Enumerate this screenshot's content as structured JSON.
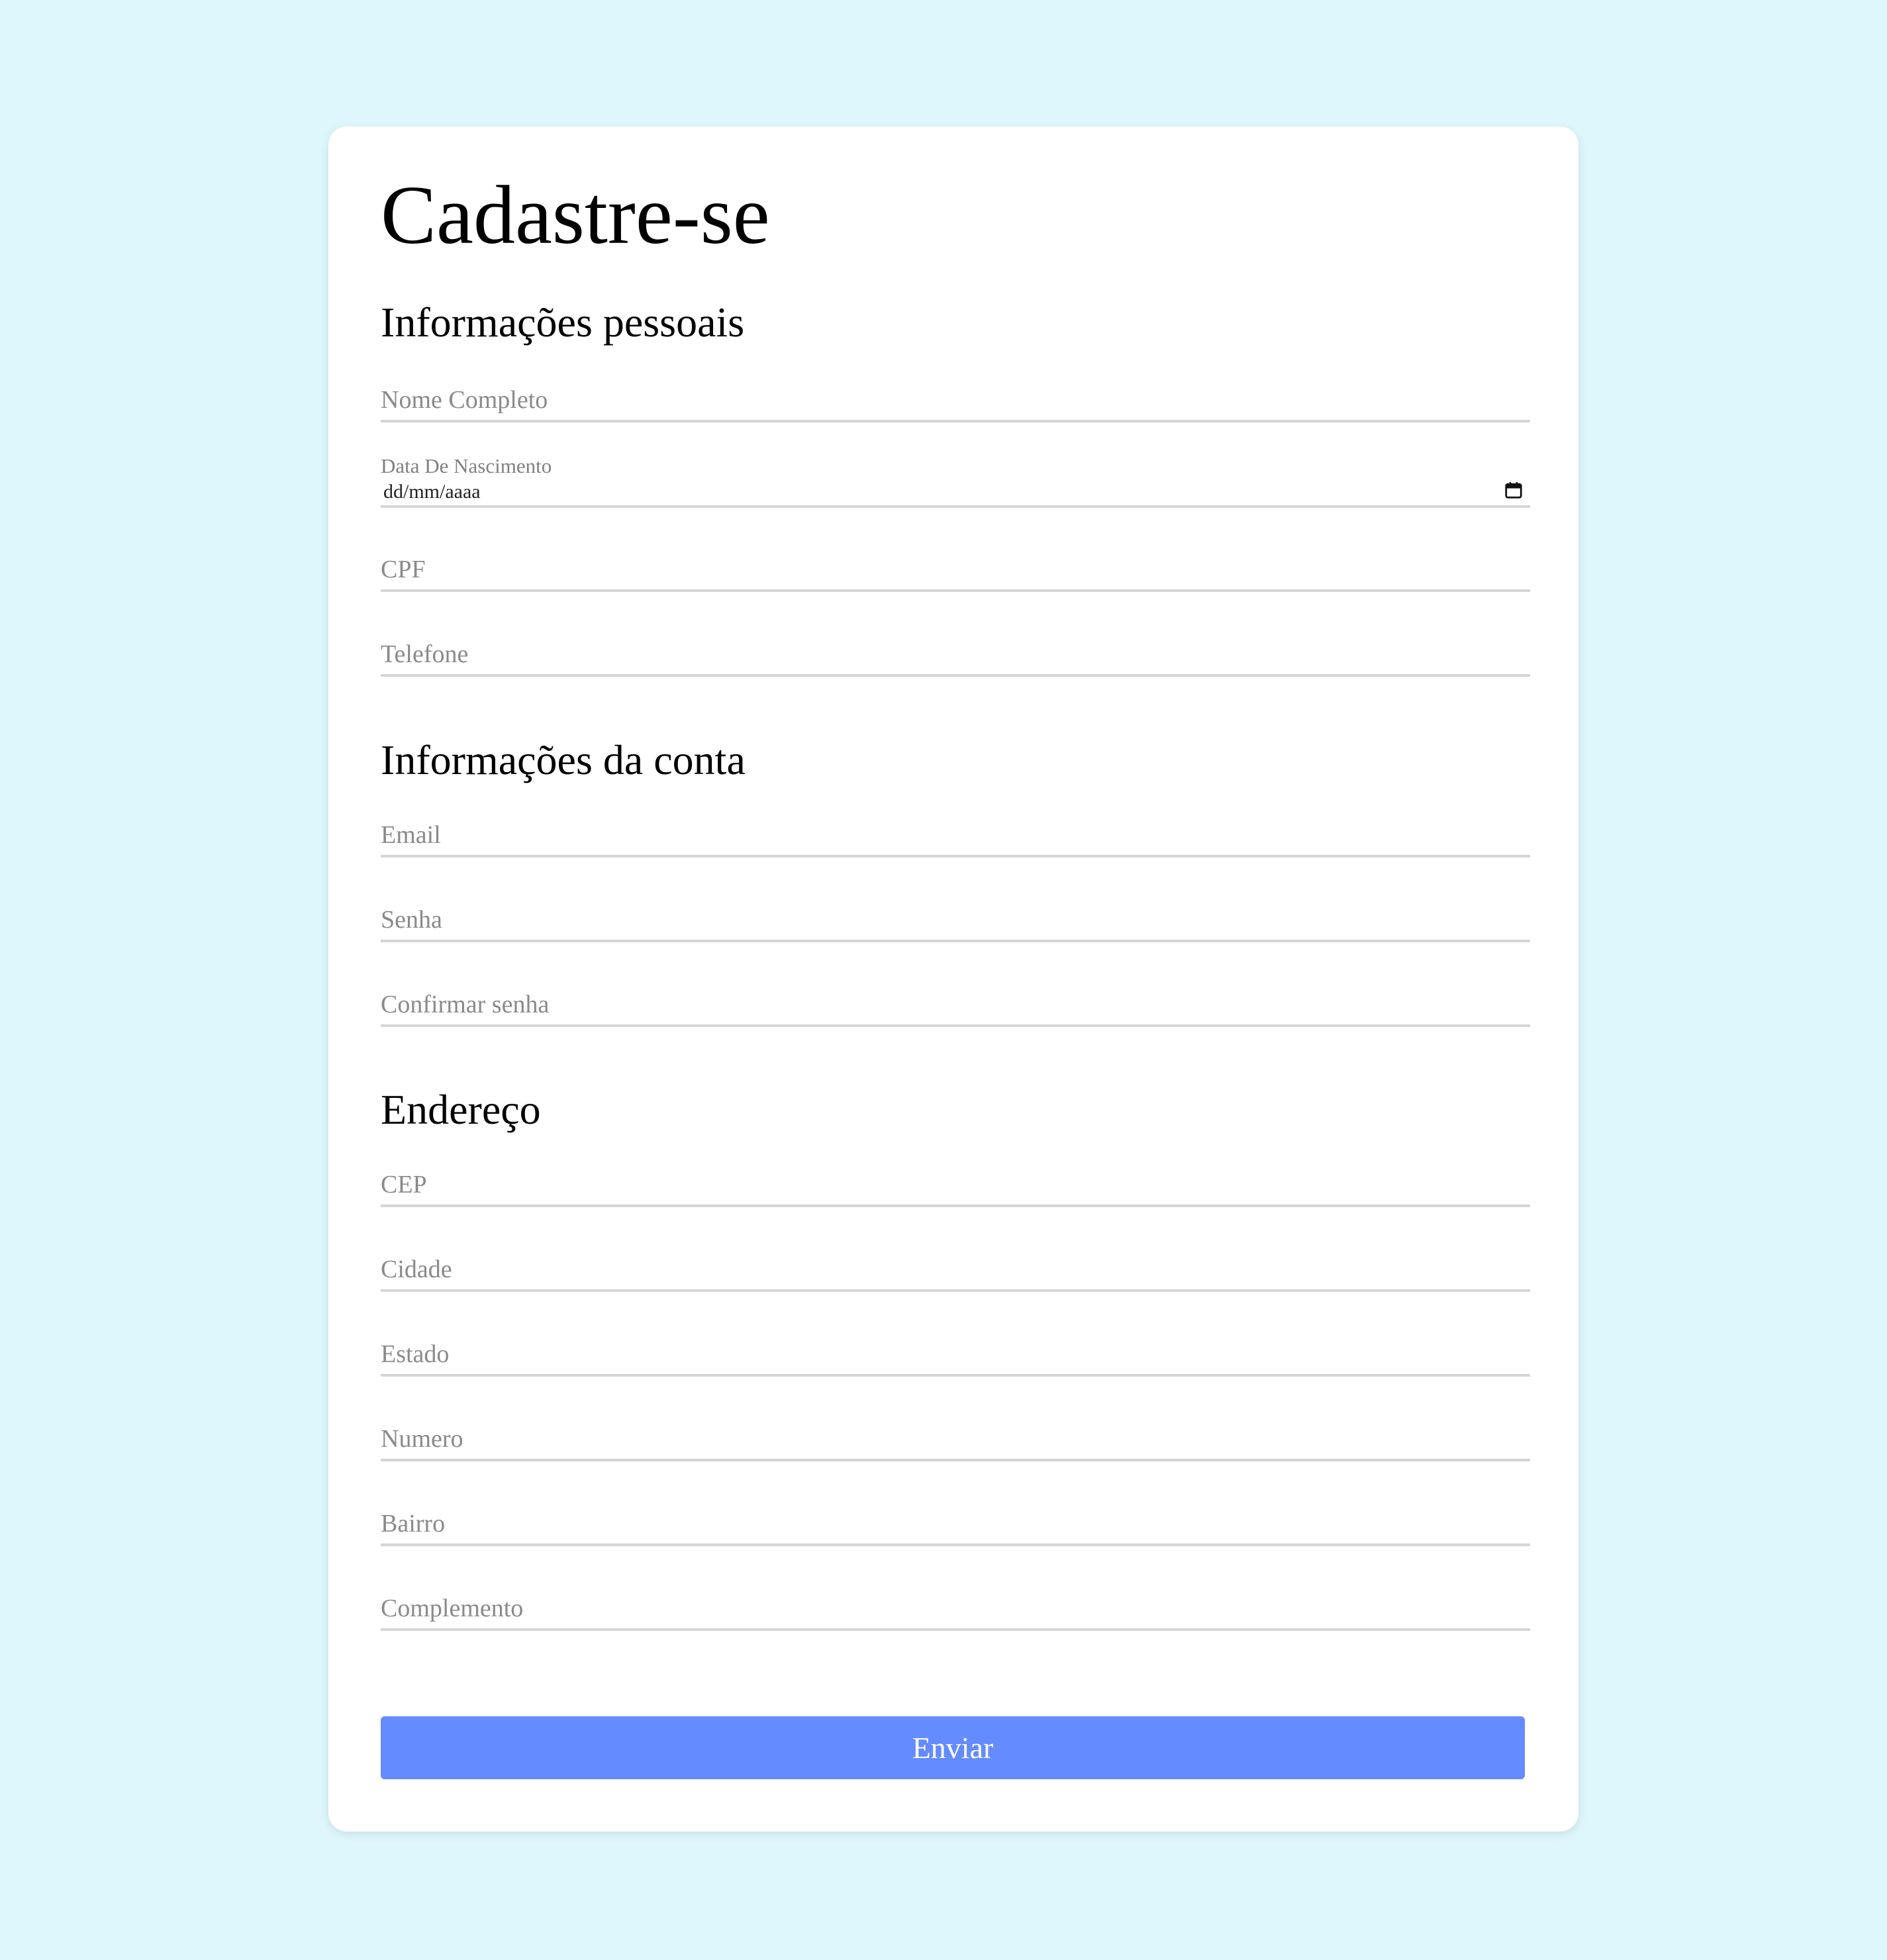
{
  "form": {
    "title": "Cadastre-se",
    "sections": {
      "personal": {
        "title": "Informações pessoais",
        "full_name_placeholder": "Nome Completo",
        "birth_date_label": "Data De Nascimento",
        "birth_date_placeholder": "dd/mm/aaaa",
        "cpf_placeholder": "CPF",
        "phone_placeholder": "Telefone"
      },
      "account": {
        "title": "Informações da conta",
        "email_placeholder": "Email",
        "password_placeholder": "Senha",
        "confirm_password_placeholder": "Confirmar senha"
      },
      "address": {
        "title": "Endereço",
        "cep_placeholder": "CEP",
        "city_placeholder": "Cidade",
        "state_placeholder": "Estado",
        "number_placeholder": "Numero",
        "neighborhood_placeholder": "Bairro",
        "complement_placeholder": "Complemento"
      }
    },
    "submit_label": "Enviar",
    "icons": {
      "birth_date": "calendar-icon"
    },
    "colors": {
      "page_background": "#def7fd",
      "card_background": "#ffffff",
      "submit_background": "#648bff",
      "placeholder_text": "#8a8a8a",
      "field_underline": "#d5d5d5"
    }
  }
}
